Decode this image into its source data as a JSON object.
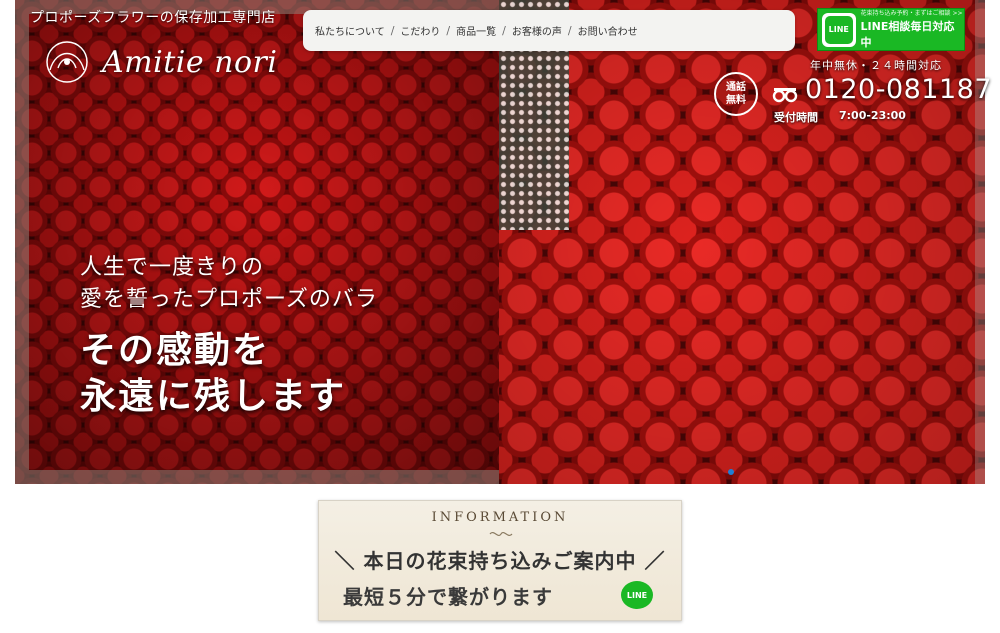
{
  "header": {
    "tagline": "プロポーズフラワーの保存加工専門店",
    "logo_text": "Amitie nori"
  },
  "nav": {
    "items": [
      "私たちについて",
      "こだわり",
      "商品一覧",
      "お客様の声",
      "お問い合わせ"
    ],
    "separator": "/"
  },
  "line_box": {
    "icon_label": "LINE",
    "small_text": "花束持ち込み予約・まずはご相談 >>",
    "main_text": "LINE相談毎日対応中"
  },
  "contact": {
    "free_badge_line1": "通話",
    "free_badge_line2": "無料",
    "open_note": "年中無休・２４時間対応",
    "phone": "0120-081187",
    "hours_label": "受付時間",
    "hours_value": "7:00-23:00"
  },
  "hero": {
    "line1": "人生で一度きりの",
    "line2": "愛を誓ったプロポーズのバラ",
    "big1": "その感動を",
    "big2": "永遠に残します"
  },
  "info_banner": {
    "title": "INFORMATION",
    "line1": "＼ 本日の花束持ち込みご案内中 ／",
    "line2": "最短５分で繋がります",
    "line_icon_label": "LINE"
  },
  "colors": {
    "line_green": "#1ab824",
    "rose_red": "#d21a1a",
    "slider_dot": "#1e7fd6"
  }
}
